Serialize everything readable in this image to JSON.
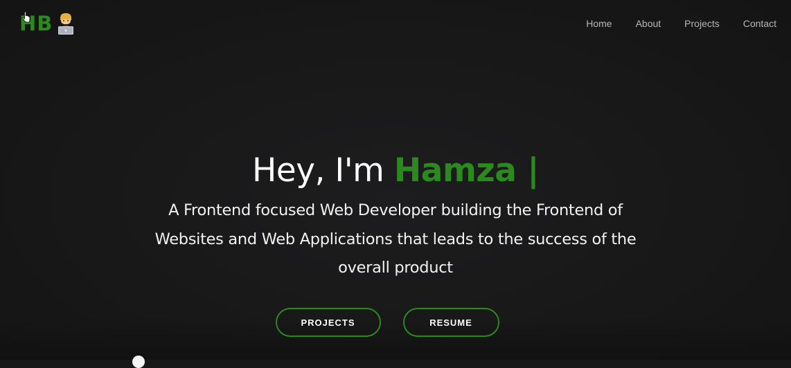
{
  "header": {
    "logo_text": "HB",
    "logo_icon": "technologist-emoji-icon",
    "nav": [
      {
        "label": "Home"
      },
      {
        "label": "About"
      },
      {
        "label": "Projects"
      },
      {
        "label": "Contact"
      }
    ]
  },
  "hero": {
    "greeting": "Hey, I'm ",
    "name": "Hamza",
    "caret": " |",
    "tagline": "A Frontend focused Web Developer building the Frontend of Websites and Web Applications that leads to the success of the overall product",
    "buttons": {
      "projects_label": "PROJECTS",
      "resume_label": "RESUME"
    }
  },
  "colors": {
    "background": "#181818",
    "accent": "#2b8a1e",
    "nav_text": "#b8b8b8",
    "heading_text": "#ffffff"
  }
}
